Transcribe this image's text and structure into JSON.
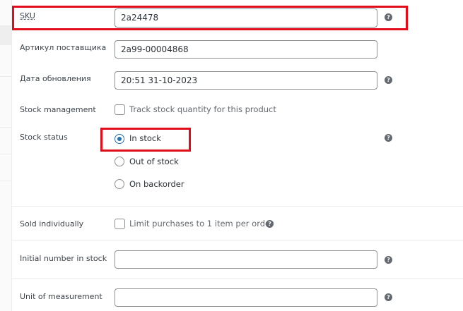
{
  "fields": {
    "sku": {
      "label": "SKU",
      "value": "2a24478"
    },
    "supplier_article": {
      "label": "Артикул поставщика",
      "value": "2a99-00004868"
    },
    "update_date": {
      "label": "Дата обновления",
      "value": "20:51 31-10-2023"
    },
    "stock_management": {
      "label": "Stock management",
      "checkbox_label": "Track stock quantity for this product",
      "checked": false
    },
    "stock_status": {
      "label": "Stock status",
      "options": [
        "In stock",
        "Out of stock",
        "On backorder"
      ],
      "selected": "In stock"
    },
    "sold_individually": {
      "label": "Sold individually",
      "checkbox_label": "Limit purchases to 1 item per order",
      "checked": false
    },
    "initial_stock": {
      "label": "Initial number in stock",
      "value": ""
    },
    "unit_of_measurement": {
      "label": "Unit of measurement",
      "value": ""
    }
  },
  "help_glyph": "?",
  "icons": {
    "help": "help-tip-icon"
  },
  "colors": {
    "highlight": "#e10d1a",
    "radio_accent": "#2271b1"
  }
}
